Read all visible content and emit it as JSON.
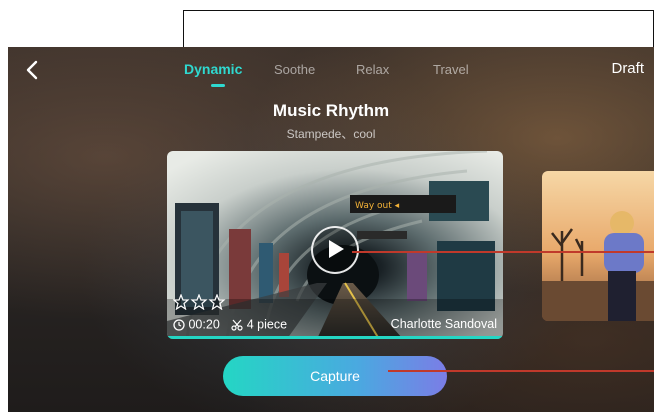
{
  "header": {
    "tabs": [
      {
        "label": "Dynamic",
        "active": true
      },
      {
        "label": "Soothe",
        "active": false
      },
      {
        "label": "Relax",
        "active": false
      },
      {
        "label": "Travel",
        "active": false
      }
    ],
    "draft_label": "Draft"
  },
  "template": {
    "title": "Music Rhythm",
    "subtitle": "Stampede、cool",
    "duration": "00:20",
    "pieces": "4 piece",
    "author": "Charlotte Sandoval",
    "rating": 0
  },
  "capture_label": "Capture",
  "colors": {
    "accent": "#2fd9d0",
    "capture_gradient_start": "#24d6c4",
    "capture_gradient_end": "#7b7de6",
    "annotation_red": "#c0392b"
  },
  "icons": [
    "chevron-left-icon",
    "play-icon",
    "star-icon",
    "clock-icon",
    "scissors-icon"
  ]
}
